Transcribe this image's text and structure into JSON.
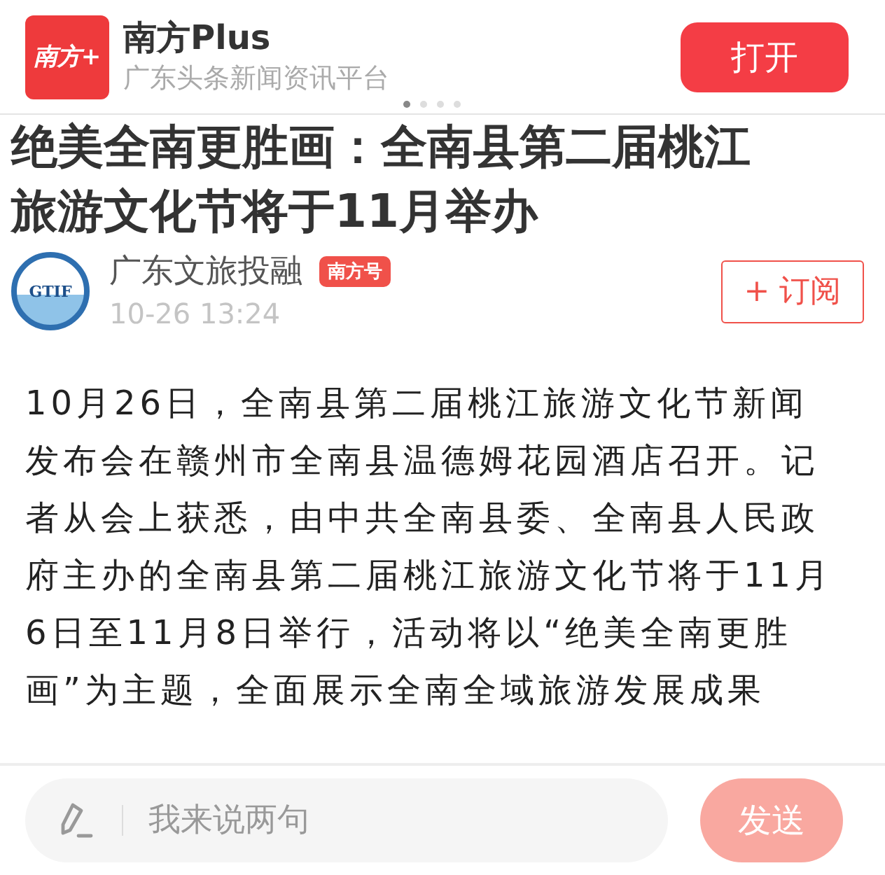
{
  "app_banner": {
    "logo_text": "南方+",
    "name": "南方Plus",
    "tagline": "广东头条新闻资讯平台",
    "open_button": "打开",
    "pager": [
      {
        "selected": true
      },
      {
        "selected": false
      },
      {
        "selected": false
      },
      {
        "selected": false
      }
    ]
  },
  "article": {
    "title_lines": [
      "绝美全南更胜画：全南县第二届桃江",
      "旅游文化节将于11月举办"
    ],
    "author": {
      "avatar_text": "GTIF",
      "name": "广东文旅投融",
      "badge": "南方号",
      "time": "10-26 13:24",
      "subscribe_button": "+ 订阅"
    },
    "body": "10月26日，全南县第二届桃江旅游文化节新闻发布会在赣州市全南县温德姆花园酒店召开。记者从会上获悉，由中共全南县委、全南县人民政府主办的全南县第二届桃江旅游文化节将于11月6日至11月8日举行，活动将以“绝美全南更胜画”为主题，全面展示全南全域旅游发展成果"
  },
  "comment_bar": {
    "placeholder": "我来说两句",
    "send_button": "发送"
  }
}
